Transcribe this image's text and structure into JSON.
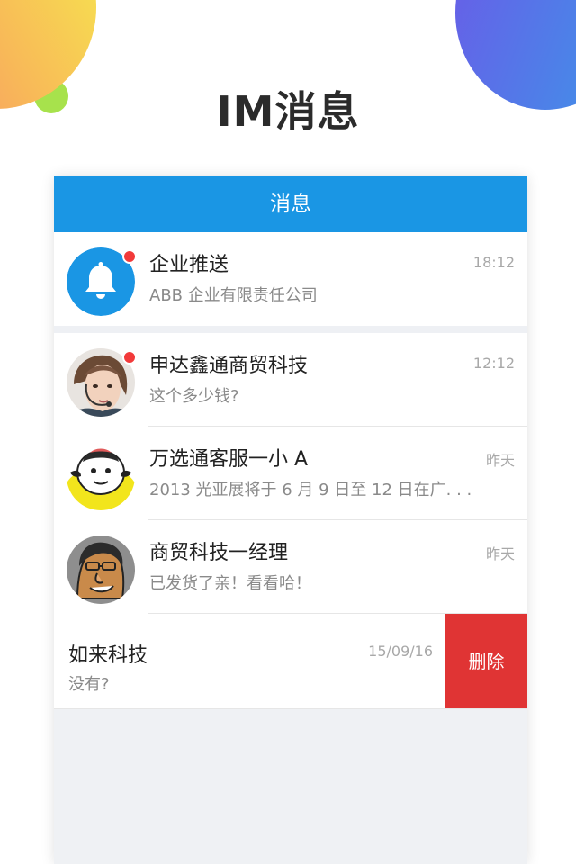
{
  "promo": {
    "title": "IM消息"
  },
  "nav": {
    "title": "消息"
  },
  "conversations": [
    {
      "name": "企业推送",
      "preview": "ABB 企业有限责任公司",
      "time": "18:12",
      "avatar_icon": "bell-icon",
      "unread": true
    },
    {
      "name": "申达鑫通商贸科技",
      "preview": "这个多少钱?",
      "time": "12:12",
      "avatar_icon": "woman-headset-avatar",
      "unread": true
    },
    {
      "name": "万选通客服一小 A",
      "preview": "2013 光亚展将于 6 月 9 日至 12 日在广. . .",
      "time": "昨天",
      "avatar_icon": "cartoon-avatar",
      "unread": false
    },
    {
      "name": "商贸科技一经理",
      "preview": "已发货了亲！看看哈！",
      "time": "昨天",
      "avatar_icon": "cartoon-man-avatar",
      "unread": false
    }
  ],
  "swiped_conversation": {
    "name": "如来科技",
    "preview": "没有?",
    "time": "15/09/16",
    "delete_label": "删除"
  },
  "colors": {
    "nav_bar": "#1a96e4",
    "delete": "#e03434",
    "badge": "#f23a3a"
  }
}
